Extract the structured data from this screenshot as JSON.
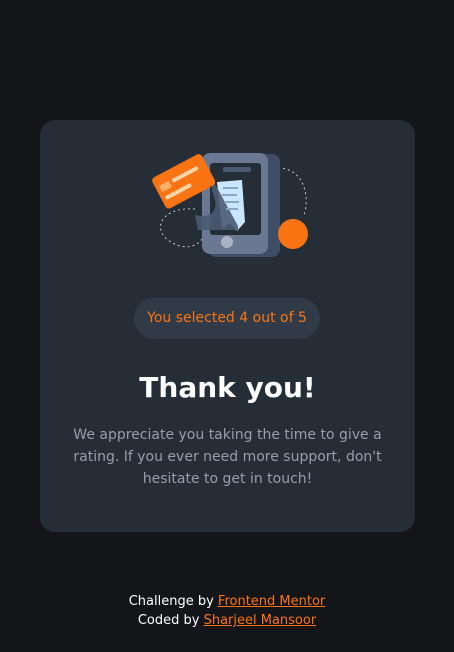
{
  "card": {
    "illustration": "payment-receipt-phone-illustration",
    "selection_text": "You selected 4 out of 5",
    "title": "Thank you!",
    "message": "We appreciate you taking the time to give a rating. If you ever need more support, don't hesitate to get in touch!"
  },
  "footer": {
    "challenge_prefix": "Challenge by",
    "challenge_link": "Frontend Mentor",
    "coded_prefix": "Coded by",
    "coded_link": "Sharjeel Mansoor"
  },
  "colors": {
    "background": "#131518",
    "card": "#252d37",
    "accent": "#fb7413",
    "text_primary": "#ffffff",
    "text_muted": "#959eac"
  }
}
